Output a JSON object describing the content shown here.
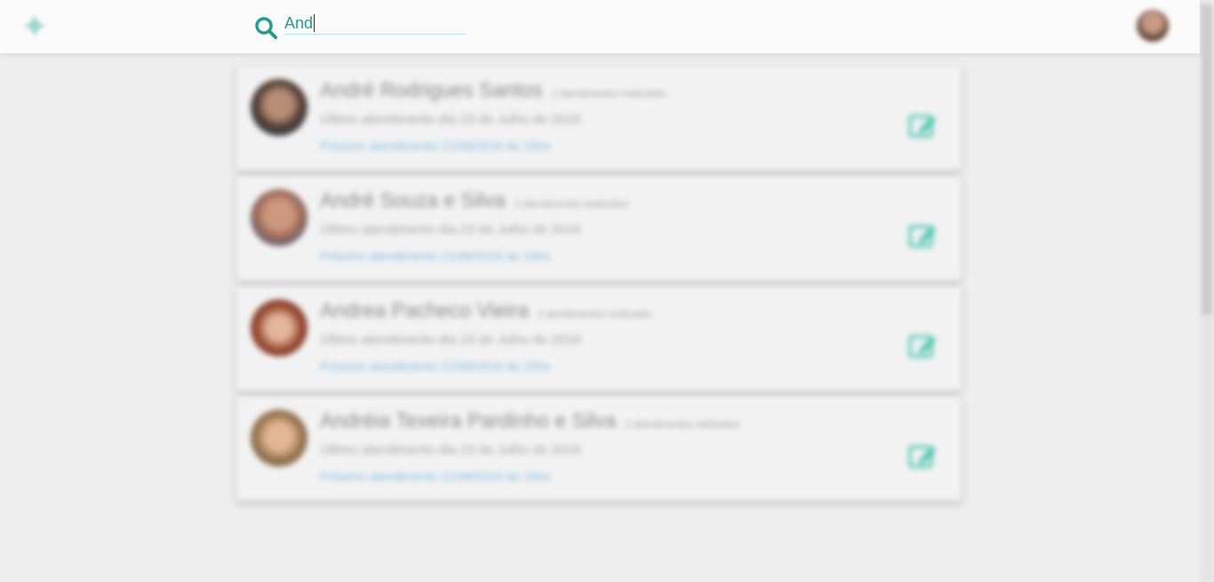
{
  "search": {
    "value": "And"
  },
  "colors": {
    "accent": "#1f9a8f",
    "link": "#7fb9e6"
  },
  "icons": {
    "logo": "app-logo-icon",
    "search": "search-icon",
    "edit": "edit-icon"
  },
  "results": [
    {
      "name": "André Rodrigues Santos",
      "tag": "2 atendimentos realizados",
      "last_visit": "Último atendimento dia 23 de Julho de 2016",
      "next_visit": "Próximo atendimento 21/08/2016 às 15hs"
    },
    {
      "name": "André Souza e Silva",
      "tag": "2 atendimentos realizados",
      "last_visit": "Último atendimento dia 23 de Julho de 2016",
      "next_visit": "Próximo atendimento 21/08/2016 às 15hs"
    },
    {
      "name": "Andrea Pacheco Vieira",
      "tag": "2 atendimentos realizados",
      "last_visit": "Último atendimento dia 23 de Julho de 2016",
      "next_visit": "Próximo atendimento 21/08/2016 às 15hs"
    },
    {
      "name": "Andréia Texeira Pardinho e Silva",
      "tag": "2 atendimentos realizados",
      "last_visit": "Último atendimento dia 23 de Julho de 2016",
      "next_visit": "Próximo atendimento 21/08/2016 às 15hs"
    }
  ]
}
